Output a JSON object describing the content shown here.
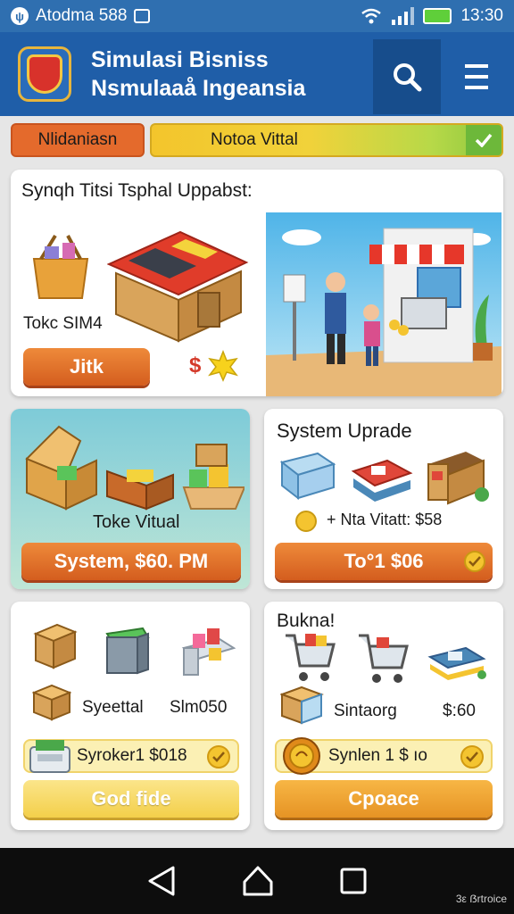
{
  "status_bar": {
    "carrier": "Atodma 588",
    "time": "13:30"
  },
  "header": {
    "title_line1": "Simulasi Bisniss",
    "title_line2": "Nsmulaaå Ingeansia"
  },
  "tabs": {
    "left_label": "Nlidaniasn",
    "right_label": "Notoa Vittal"
  },
  "card1": {
    "title": "Synqh Titsi Tsphal Uppabst:",
    "item_label": "Tokc SIM4",
    "button_label": "Jitk",
    "badge": "$"
  },
  "card2": {
    "item_label": "Toke Vitual",
    "button_label": "System, $60. PM"
  },
  "card3": {
    "title": "System Uprade",
    "price_text": "+ Nta Vitatt: $58",
    "button_label": "To°1 $06"
  },
  "card4": {
    "item_label": "Syeettal",
    "price": "Slm050",
    "bar_label": "Syroker1 $018",
    "button_label": "God fide"
  },
  "card5": {
    "title": "Bukna!",
    "item_label": "Sintaorg",
    "price": "$:60",
    "bar_label": "Synlen 1 $ ıo",
    "button_label": "Cpoace"
  },
  "nav": {
    "watermark": "3ε ẞrtroice"
  },
  "colors": {
    "header": "#1f5ea8",
    "status_bar": "#2f6fb0",
    "orange": "#e46a2c",
    "yellow": "#f3cf4a",
    "green": "#6db83a"
  }
}
